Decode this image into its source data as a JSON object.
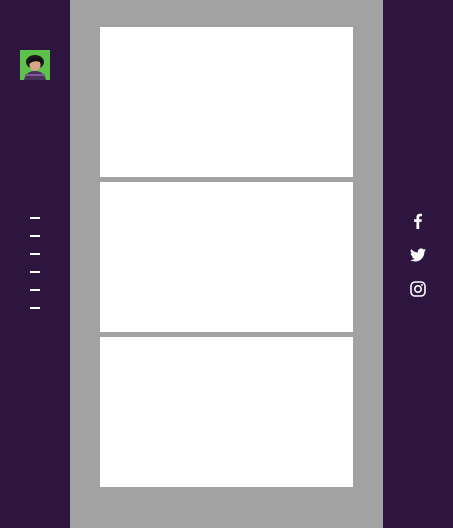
{
  "colors": {
    "sidebar_bg": "#2d1540",
    "main_bg": "#a2a2a2",
    "card_bg": "#ffffff",
    "avatar_bg": "#5cc24a",
    "icon_color": "#ffffff"
  },
  "left_sidebar": {
    "avatar": {
      "icon": "profile-avatar"
    },
    "nav_items": [
      {
        "icon": "nav-dash"
      },
      {
        "icon": "nav-dash"
      },
      {
        "icon": "nav-dash"
      },
      {
        "icon": "nav-dash"
      },
      {
        "icon": "nav-dash"
      },
      {
        "icon": "nav-dash"
      }
    ]
  },
  "main": {
    "cards": [
      {
        "content": ""
      },
      {
        "content": ""
      },
      {
        "content": ""
      }
    ]
  },
  "right_sidebar": {
    "social_links": [
      {
        "icon": "facebook-icon"
      },
      {
        "icon": "twitter-icon"
      },
      {
        "icon": "instagram-icon"
      }
    ]
  }
}
